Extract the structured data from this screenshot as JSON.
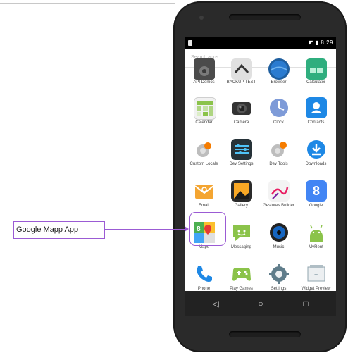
{
  "status_bar": {
    "time": "8:29"
  },
  "search": {
    "placeholder": "Search apps..."
  },
  "apps": [
    [
      "API Demos",
      "BACKUP TEST",
      "Browser",
      "Calculator"
    ],
    [
      "Calendar",
      "Camera",
      "Clock",
      "Contacts"
    ],
    [
      "Custom Locale",
      "Dev Settings",
      "Dev Tools",
      "Downloads"
    ],
    [
      "Email",
      "Gallery",
      "Gestures Builder",
      "Google"
    ],
    [
      "Maps",
      "Messaging",
      "Music",
      "MyRent"
    ],
    [
      "Phone",
      "Play Games",
      "Settings",
      "Widget Preview"
    ]
  ],
  "nav_bar": {
    "back": "◁",
    "home": "○",
    "recents": "□"
  },
  "callout": {
    "label": "Google Mapp App"
  },
  "colors": {
    "callout_accent": "#9b5bd4"
  },
  "icons": {
    "API Demos": "api-demos-icon",
    "BACKUP TEST": "backup-test-icon",
    "Browser": "browser-icon",
    "Calculator": "calculator-icon",
    "Calendar": "calendar-icon",
    "Camera": "camera-icon",
    "Clock": "clock-icon",
    "Contacts": "contacts-icon",
    "Custom Locale": "custom-locale-icon",
    "Dev Settings": "dev-settings-icon",
    "Dev Tools": "dev-tools-icon",
    "Downloads": "downloads-icon",
    "Email": "email-icon",
    "Gallery": "gallery-icon",
    "Gestures Builder": "gestures-builder-icon",
    "Google": "google-icon",
    "Maps": "maps-icon",
    "Messaging": "messaging-icon",
    "Music": "music-icon",
    "MyRent": "myrent-icon",
    "Phone": "phone-icon",
    "Play Games": "play-games-icon",
    "Settings": "settings-icon",
    "Widget Preview": "widget-preview-icon"
  }
}
